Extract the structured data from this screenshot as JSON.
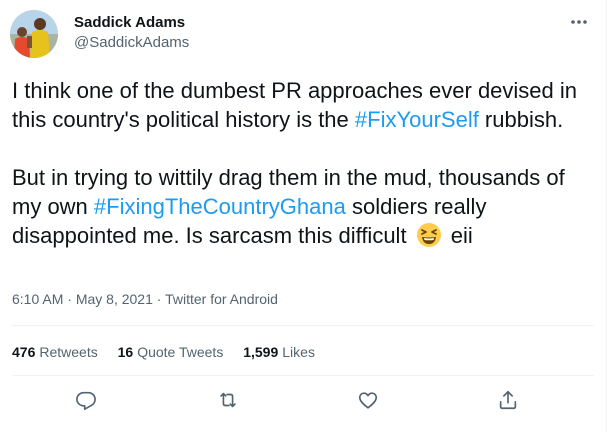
{
  "author": {
    "display_name": "Saddick Adams",
    "handle": "@SaddickAdams",
    "avatar_icon": "profile-photo"
  },
  "tweet": {
    "line1": "I think one of the dumbest PR approaches ever devised in this country's political history is the ",
    "hashtag1": "#FixYourSelf",
    "line1_end": " rubbish.",
    "line2_start": "But in trying to wittily drag them in the mud, thousands of my own ",
    "hashtag2": "#FixingTheCountryGhana",
    "line2_mid": " soldiers really disappointed me. Is sarcasm this difficult ",
    "emoji_icon": "grinning-squinting-face-emoji",
    "line2_end": " eii"
  },
  "meta": {
    "time": "6:10 AM",
    "separator1": " · ",
    "date": "May 8, 2021",
    "separator2": " · ",
    "source": "Twitter for Android"
  },
  "stats": {
    "retweets_count": "476",
    "retweets_label": "Retweets",
    "quotes_count": "16",
    "quotes_label": "Quote Tweets",
    "likes_count": "1,599",
    "likes_label": "Likes"
  },
  "actions": {
    "reply_icon": "reply-icon",
    "retweet_icon": "retweet-icon",
    "like_icon": "heart-icon",
    "share_icon": "share-icon"
  },
  "colors": {
    "accent": "#1d9bf0",
    "text": "#0f1419",
    "secondary": "#536471",
    "divider": "#eff3f4"
  }
}
